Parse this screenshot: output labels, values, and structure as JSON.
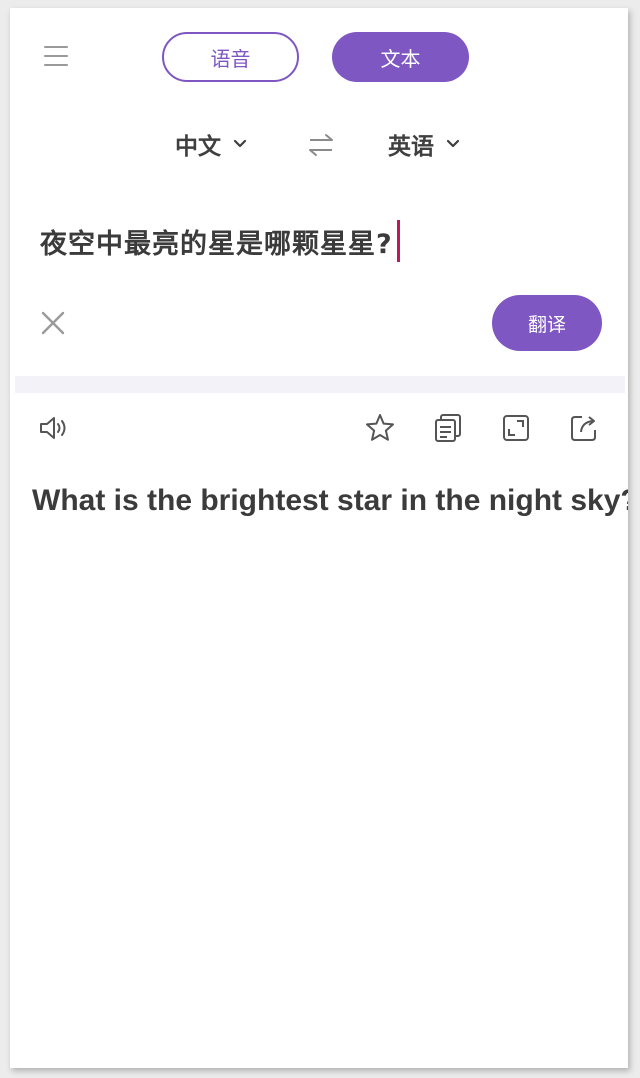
{
  "header": {
    "menu_icon": "hamburger-menu-icon",
    "modes": [
      {
        "label": "语音",
        "active": false
      },
      {
        "label": "文本",
        "active": true
      }
    ]
  },
  "languages": {
    "source": "中文",
    "target": "英语",
    "swap_icon": "swap-arrows-icon"
  },
  "input": {
    "text": "夜空中最亮的星是哪颗星星?",
    "clear_icon": "close-icon"
  },
  "translate_button": "翻译",
  "toolbar": {
    "icons": [
      "speaker-icon",
      "star-icon",
      "copy-icon",
      "expand-icon",
      "share-icon"
    ]
  },
  "result": {
    "text": "What is the brightest star in the night sky?"
  },
  "colors": {
    "accent": "#7e57c2",
    "caret": "#c2185b",
    "text": "#3b3b3b",
    "icon": "#666666",
    "divider": "#f3f2f8"
  }
}
